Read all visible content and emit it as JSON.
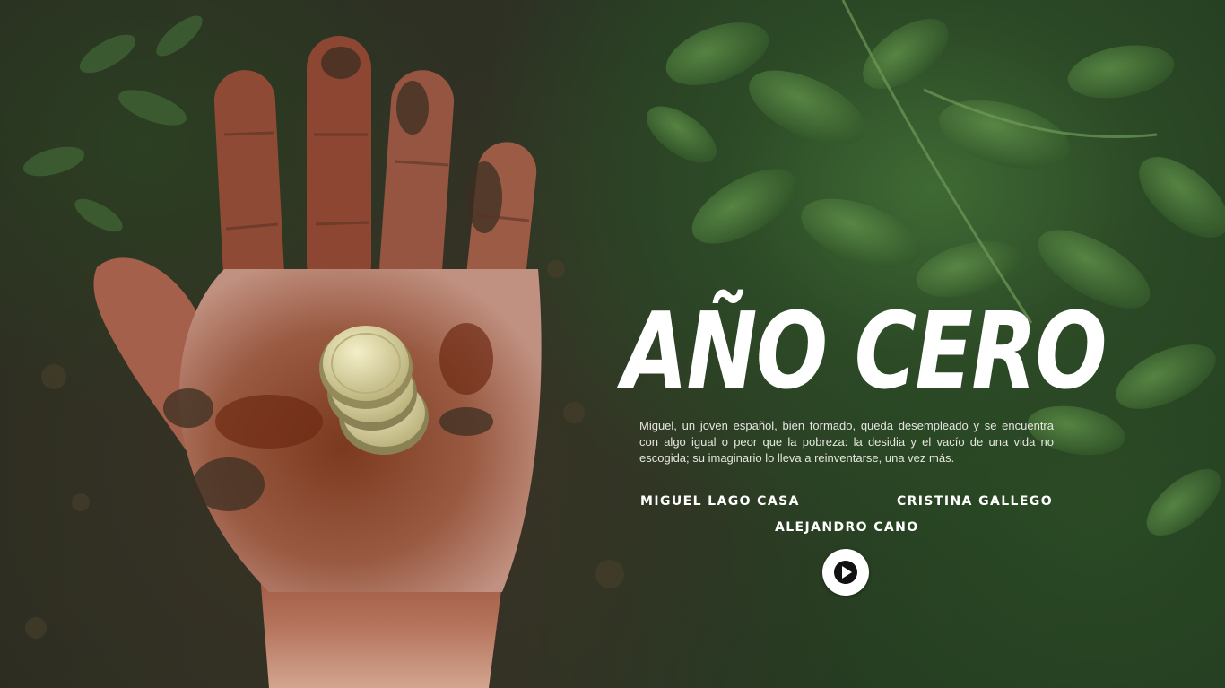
{
  "hero": {
    "title": "AÑO CERO",
    "synopsis": "Miguel, un joven español, bien formado, queda desempleado y se encuentra con algo igual o peor que la pobreza: la desidia y el vacío de una vida no escogida; su imaginario lo lleva a reinventarse, una vez más."
  },
  "credits": [
    "MIGUEL LAGO CASA",
    "CRISTINA GALLEGO",
    "ALEJANDRO CANO"
  ],
  "play": {
    "icon": "play-icon"
  },
  "colors": {
    "text": "#ffffff",
    "foliage": "#3f6a34",
    "soil": "#3a3426",
    "rust": "#7a2e16",
    "coin": "#e8e2b0"
  }
}
